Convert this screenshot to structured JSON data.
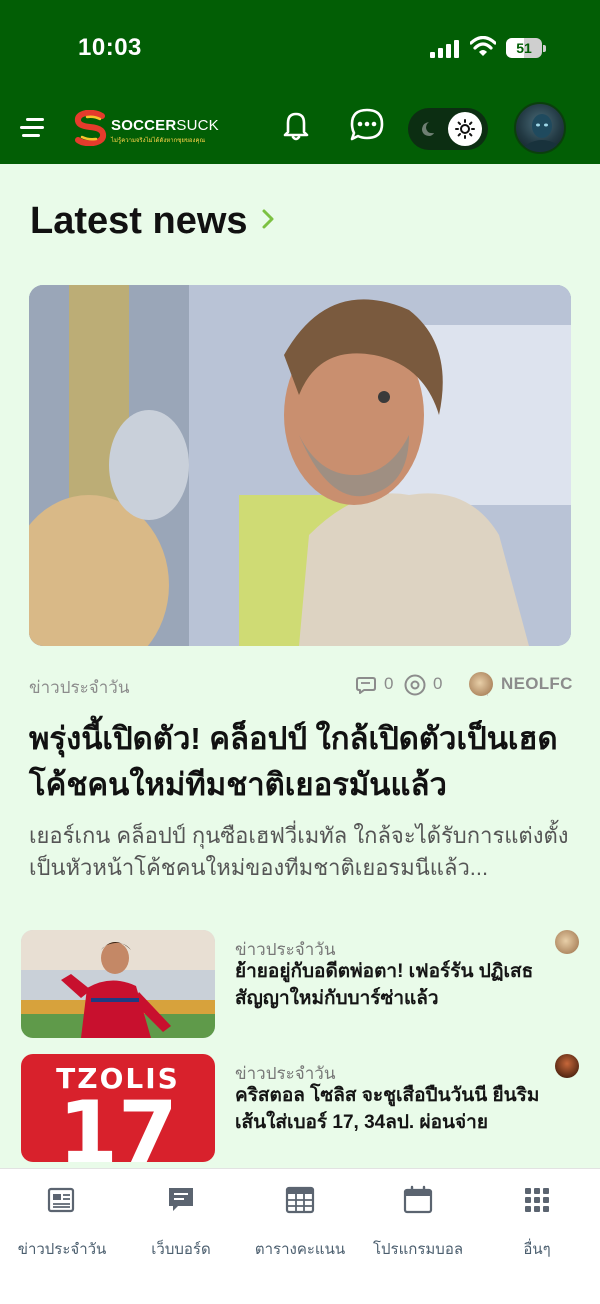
{
  "status_bar": {
    "time": "10:03",
    "battery": "51",
    "battery_fraction": 0.51
  },
  "header": {
    "logo_primary": "SOCCER",
    "logo_secondary": "SUCK",
    "logo_tagline": "ไม่รู้ความจริงไม่ได้ดังหากซุยของคุณ"
  },
  "section": {
    "title": "Latest news"
  },
  "hero": {
    "category": "ข่าวประจำวัน",
    "comments": "0",
    "views": "0",
    "author": "NEOLFC",
    "title": "พรุ่งนี้เปิดตัว! คล็อปป์ ใกล้เปิดตัวเป็นเฮดโค้ชคนใหม่ทีมชาติเยอรมันแล้ว",
    "description": "เยอร์เกน คล็อปป์ กุนซือเฮฟวี่เมทัล ใกล้จะได้รับการแต่งตั้งเป็นหัวหน้าโค้ชคนใหม่ของทีมชาติเยอรมนีแล้ว..."
  },
  "news_items": [
    {
      "category": "ข่าวประจำวัน",
      "title": "ย้ายอยู่กับอดีตพ่อตา! เฟอร์รัน ปฏิเสธสัญญาใหม่กับบาร์ซ่าแล้ว"
    },
    {
      "category": "ข่าวประจำวัน",
      "title": "คริสตอล โซลิส จะชูเสือปืนวันนี ยืนริมเส้นใส่เบอร์ 17, 34ลป. ผ่อนจ่าย",
      "shirt_name": "TZOLIS",
      "shirt_number": "17"
    }
  ],
  "bottom_nav": [
    {
      "label": "ข่าวประจำวัน",
      "icon": "newspaper-icon"
    },
    {
      "label": "เว็บบอร์ด",
      "icon": "message-board-icon"
    },
    {
      "label": "ตารางคะแนน",
      "icon": "table-icon"
    },
    {
      "label": "โปรแกรมบอล",
      "icon": "calendar-icon"
    },
    {
      "label": "อื่นๆ",
      "icon": "grid-icon"
    }
  ],
  "colors": {
    "header_bg": "#025e05",
    "page_bg": "#e9fbe9",
    "accent": "#7cc142"
  }
}
